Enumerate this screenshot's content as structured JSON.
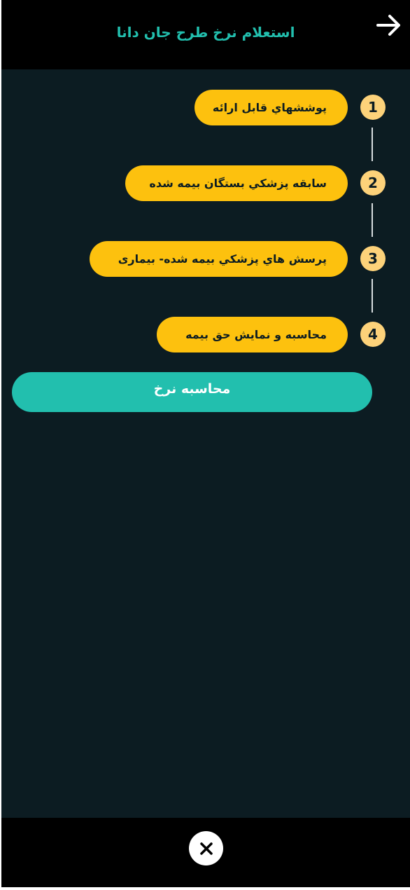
{
  "header": {
    "title": "استعلام نرخ طرح جان دانا",
    "back_icon": "arrow-right-icon"
  },
  "steps": [
    {
      "number": "1",
      "label": "پوششهاي قابل ارائه"
    },
    {
      "number": "2",
      "label": "سابقه پزشکي بستگان بیمه شده"
    },
    {
      "number": "3",
      "label": "پرسش هاي پزشکي بیمه شده- بیماری"
    },
    {
      "number": "4",
      "label": "محاسبه و نمایش حق بیمه"
    }
  ],
  "calc_button": {
    "label": "محاسبه نرخ"
  },
  "footer": {
    "close_icon": "close-icon"
  },
  "colors": {
    "accent": "#22bfae",
    "step_pill": "#fdc10e",
    "step_number": "#fdd27a",
    "background": "#0c1c22",
    "bar": "#000000"
  }
}
